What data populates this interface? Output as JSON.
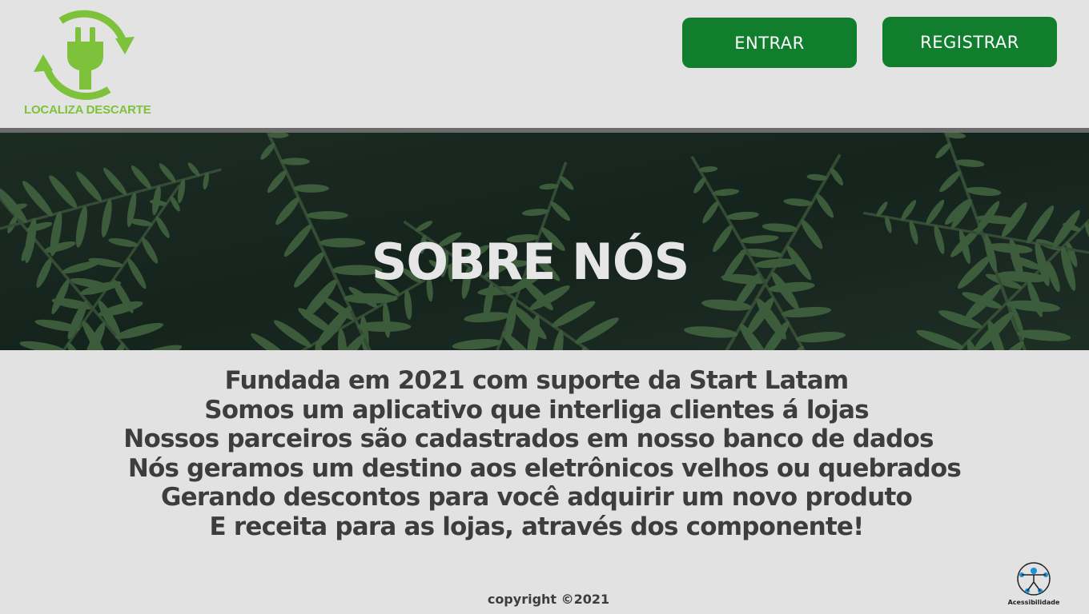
{
  "header": {
    "logo_text": "LOCALIZA DESCARTE",
    "enter_label": "ENTRAR",
    "register_label": "REGISTRAR"
  },
  "banner": {
    "title": "SOBRE NÓS"
  },
  "about": {
    "lines": [
      "Fundada em 2021 com suporte da Start Latam",
      "Somos um aplicativo que interliga clientes á lojas",
      "Nossos parceiros são cadastrados em nosso banco de dados",
      "Nós geramos um destino aos eletrônicos velhos ou quebrados",
      "Gerando descontos para você adquirir um  novo produto",
      "E receita para as lojas, através dos componente!"
    ]
  },
  "footer": {
    "copyright": "copyright ©2021",
    "accessibility_label": "Acessibilidade"
  },
  "icons": {
    "logo": "recycle-plug-icon",
    "accessibility": "accessibility-person-icon"
  },
  "colors": {
    "brand_green": "#7dc23a",
    "button_green": "#107e2d",
    "background": "#e2e2e2",
    "text": "#3d3d3d"
  }
}
